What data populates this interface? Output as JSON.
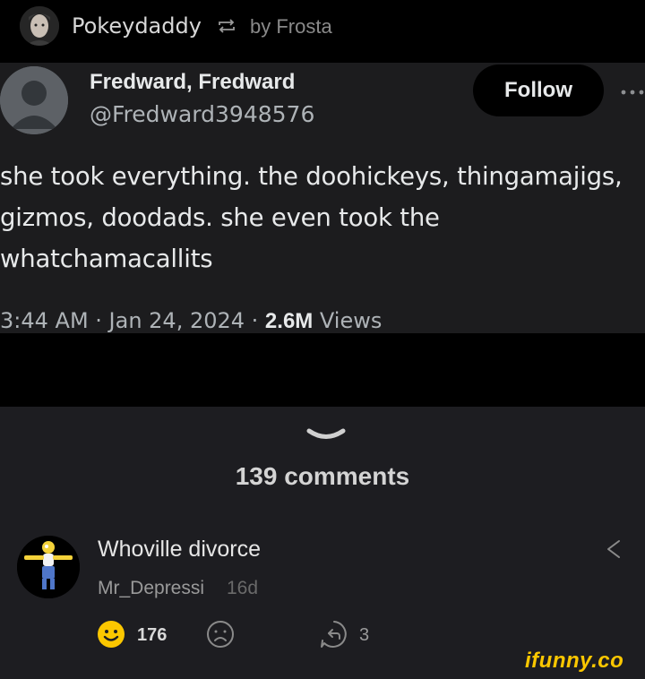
{
  "header": {
    "poster_name": "Pokeydaddy",
    "by_text": "by Frosta"
  },
  "tweet": {
    "name": "Fredward, Fredward",
    "handle": "@Fredward3948576",
    "follow_label": "Follow",
    "text": "she took everything. the doohickeys, thingamajigs, gizmos, doodads. she even took the whatchamacallits",
    "meta_prefix": "3:44 AM · Jan 24, 2024 · ",
    "views_count": "2.6M",
    "views_label": " Views"
  },
  "comments": {
    "count_label": "139 comments",
    "items": [
      {
        "title": "Whoville divorce",
        "user": "Mr_Depressi",
        "time": "16d",
        "smiles": "176",
        "replies": "3"
      }
    ]
  },
  "watermark": "ifunny.co",
  "colors": {
    "accent_yellow": "#fbc700",
    "tweet_bg": "#1c1c1e",
    "comments_bg": "#1d1d21"
  },
  "icons": [
    "repost-icon",
    "more-icon",
    "chevron-down-icon",
    "share-icon",
    "smile-icon",
    "frown-icon",
    "reply-icon"
  ]
}
